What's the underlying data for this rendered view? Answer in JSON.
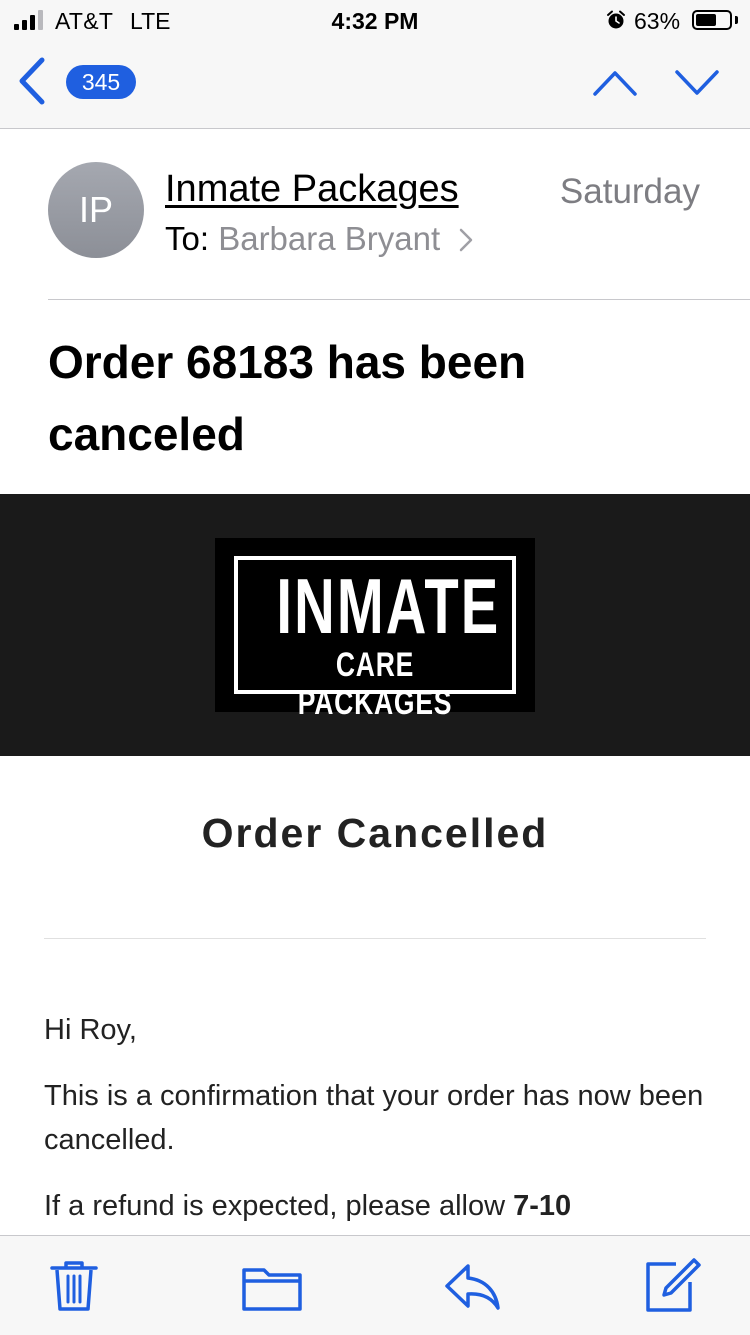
{
  "status_bar": {
    "carrier": "AT&T",
    "network": "LTE",
    "time": "4:32 PM",
    "battery_percent": "63%",
    "battery_level": 0.63
  },
  "nav": {
    "back_icon": "chevron-left-icon",
    "unread_count": "345",
    "prev_icon": "chevron-up-icon",
    "next_icon": "chevron-down-icon",
    "accent_color": "#1f5fe0"
  },
  "email": {
    "avatar_initials": "IP",
    "sender": "Inmate Packages",
    "date": "Saturday",
    "to_label": "To:",
    "recipient": "Barbara Bryant",
    "subject": "Order 68183 has been canceled"
  },
  "body": {
    "logo_line1": "INMATE",
    "logo_line2": "CARE PACKAGES",
    "heading": "Order Cancelled",
    "greeting": "Hi Roy,",
    "paragraph1": "This is a confirmation that your order has now been cancelled.",
    "paragraph2_start": "If a refund is expected, please allow",
    "paragraph2_bold": "7-10"
  },
  "toolbar": {
    "icons": [
      "trash-icon",
      "folder-icon",
      "reply-icon",
      "compose-icon"
    ]
  }
}
